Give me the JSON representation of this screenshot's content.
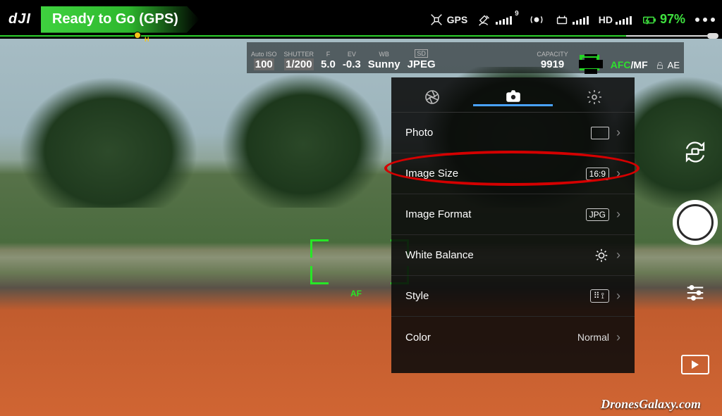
{
  "top": {
    "logo": "dJI",
    "status": "Ready to Go (GPS)",
    "gps_label": "GPS",
    "sat_count": "9",
    "hd_label": "HD",
    "battery": "97%",
    "progress_h_label": "H"
  },
  "params": {
    "iso_label": "Auto ISO",
    "iso": "100",
    "shutter_label": "SHUTTER",
    "shutter": "1/200",
    "f_label": "F",
    "f": "5.0",
    "ev_label": "EV",
    "ev": "-0.3",
    "wb_label": "WB",
    "wb": "Sunny",
    "fmt_label": "SD",
    "fmt": "JPEG",
    "cap_label": "CAPACITY",
    "cap": "9919",
    "afc": "AFC",
    "mf": "/MF",
    "ae": "AE"
  },
  "menu": {
    "rows": {
      "photo": {
        "label": "Photo"
      },
      "size": {
        "label": "Image Size",
        "value": "16:9"
      },
      "format": {
        "label": "Image Format",
        "value": "JPG"
      },
      "wb": {
        "label": "White Balance"
      },
      "style": {
        "label": "Style"
      },
      "color": {
        "label": "Color",
        "value": "Normal"
      }
    }
  },
  "af_label": "AF",
  "watermark": "DronesGalaxy.com"
}
